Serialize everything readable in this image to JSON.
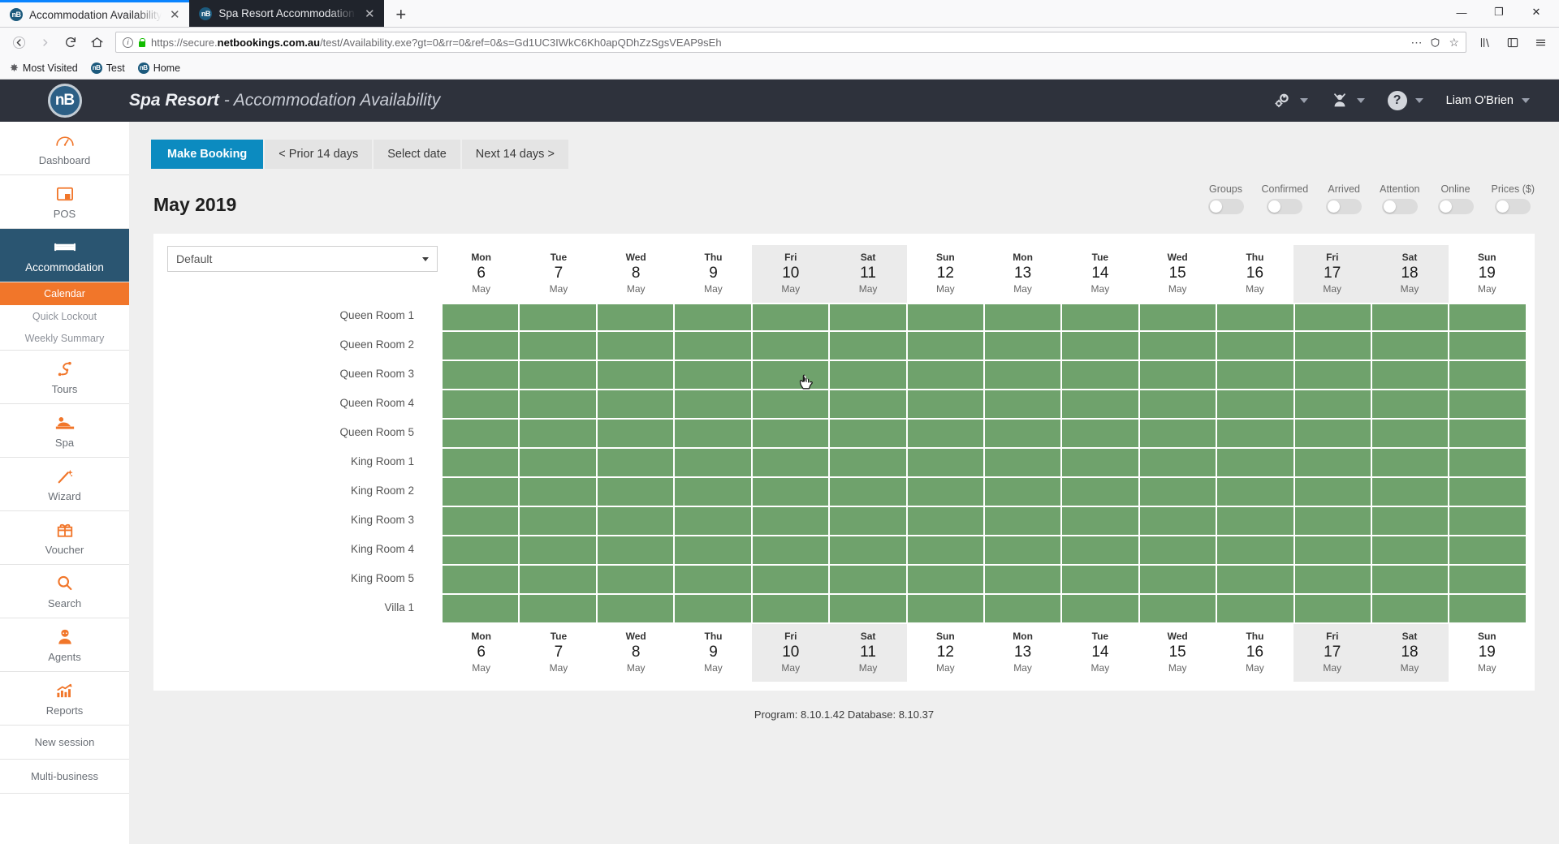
{
  "browser": {
    "tabs": [
      {
        "title": "Accommodation Availability",
        "favicon": "nB",
        "close": "✕",
        "active": false
      },
      {
        "title": "Spa Resort Accommodation C",
        "favicon": "nB",
        "close": "✕",
        "active": true
      }
    ],
    "new_tab": "+",
    "window_controls": {
      "minimize": "—",
      "maximize": "❐",
      "close": "✕"
    },
    "nav": {
      "back": "←",
      "forward": "→",
      "reload": "↻",
      "home": "⌂"
    },
    "url": {
      "scheme": "https://secure.",
      "domain": "netbookings.com.au",
      "path": "/test/Availability.exe?gt=0&rr=0&ref=0&s=Gd1UC3IWkC6Kh0apQDhZzSgsVEAP9sEh",
      "full": "https://secure.netbookings.com.au/test/Availability.exe?gt=0&rr=0&ref=0&s=Gd1UC3IWkC6Kh0apQDhZzSgsVEAP9sEh",
      "menu_dots": "⋯",
      "star": "☆"
    },
    "bookmarks": [
      {
        "label": "Most Visited",
        "icon": "star-icon"
      },
      {
        "label": "Test",
        "icon": "nb-icon"
      },
      {
        "label": "Home",
        "icon": "nb-icon"
      }
    ],
    "toolbar_right": {
      "library": "library-icon",
      "sidebar": "sidebar-icon",
      "menu": "hamburger-icon"
    }
  },
  "header": {
    "logo_text": "nB",
    "business": "Spa Resort",
    "separator": " - ",
    "section": "Accommodation Availability",
    "icons": [
      {
        "name": "settings-gears-icon",
        "glyph": "⚙"
      },
      {
        "name": "user-switch-icon",
        "glyph": "♟"
      },
      {
        "name": "help-icon",
        "glyph": "?"
      }
    ],
    "user": "Liam O'Brien"
  },
  "sidebar": {
    "items": [
      {
        "label": "Dashboard",
        "icon": "gauge-icon",
        "active": false
      },
      {
        "label": "POS",
        "icon": "pos-terminal-icon",
        "active": false
      },
      {
        "label": "Accommodation",
        "icon": "bed-icon",
        "active": true
      },
      {
        "label": "Tours",
        "icon": "tours-route-icon",
        "active": false
      },
      {
        "label": "Spa",
        "icon": "spa-massage-icon",
        "active": false
      },
      {
        "label": "Wizard",
        "icon": "magic-wand-icon",
        "active": false
      },
      {
        "label": "Voucher",
        "icon": "gift-icon",
        "active": false
      },
      {
        "label": "Search",
        "icon": "magnifier-icon",
        "active": false
      },
      {
        "label": "Agents",
        "icon": "agent-person-icon",
        "active": false
      },
      {
        "label": "Reports",
        "icon": "chart-up-icon",
        "active": false
      }
    ],
    "sub_items": [
      {
        "label": "Calendar",
        "selected": true
      },
      {
        "label": "Quick Lockout",
        "selected": false
      },
      {
        "label": "Weekly Summary",
        "selected": false
      }
    ],
    "plain_items": [
      {
        "label": "New session"
      },
      {
        "label": "Multi-business"
      }
    ]
  },
  "toolbar": {
    "make_booking": "Make Booking",
    "prior_14": "< Prior 14 days",
    "select_date": "Select date",
    "next_14": "Next 14 days >"
  },
  "calendar": {
    "month_title": "May 2019",
    "view_select": {
      "value": "Default"
    },
    "toggles": [
      {
        "label": "Groups",
        "on": false
      },
      {
        "label": "Confirmed",
        "on": false
      },
      {
        "label": "Arrived",
        "on": false
      },
      {
        "label": "Attention",
        "on": false
      },
      {
        "label": "Online",
        "on": false
      },
      {
        "label": "Prices ($)",
        "on": false
      }
    ],
    "days": [
      {
        "dow": "Mon",
        "num": "6",
        "mon": "May",
        "weekend": false
      },
      {
        "dow": "Tue",
        "num": "7",
        "mon": "May",
        "weekend": false
      },
      {
        "dow": "Wed",
        "num": "8",
        "mon": "May",
        "weekend": false
      },
      {
        "dow": "Thu",
        "num": "9",
        "mon": "May",
        "weekend": false
      },
      {
        "dow": "Fri",
        "num": "10",
        "mon": "May",
        "weekend": true
      },
      {
        "dow": "Sat",
        "num": "11",
        "mon": "May",
        "weekend": true
      },
      {
        "dow": "Sun",
        "num": "12",
        "mon": "May",
        "weekend": false
      },
      {
        "dow": "Mon",
        "num": "13",
        "mon": "May",
        "weekend": false
      },
      {
        "dow": "Tue",
        "num": "14",
        "mon": "May",
        "weekend": false
      },
      {
        "dow": "Wed",
        "num": "15",
        "mon": "May",
        "weekend": false
      },
      {
        "dow": "Thu",
        "num": "16",
        "mon": "May",
        "weekend": false
      },
      {
        "dow": "Fri",
        "num": "17",
        "mon": "May",
        "weekend": true
      },
      {
        "dow": "Sat",
        "num": "18",
        "mon": "May",
        "weekend": true
      },
      {
        "dow": "Sun",
        "num": "19",
        "mon": "May",
        "weekend": false
      }
    ],
    "rooms": [
      "Queen Room 1",
      "Queen Room 2",
      "Queen Room 3",
      "Queen Room 4",
      "Queen Room 5",
      "King Room 1",
      "King Room 2",
      "King Room 3",
      "King Room 4",
      "King Room 5",
      "Villa 1"
    ],
    "cell_status": "available",
    "available_color": "#6fa26c"
  },
  "footer": {
    "text": "Program: 8.10.1.42 Database: 8.10.37"
  },
  "colors": {
    "accent_orange": "#f1762a",
    "header_dark": "#2e323c",
    "active_blue": "#2a5571",
    "primary_button": "#0c8bc0",
    "available_green": "#6fa26c"
  }
}
